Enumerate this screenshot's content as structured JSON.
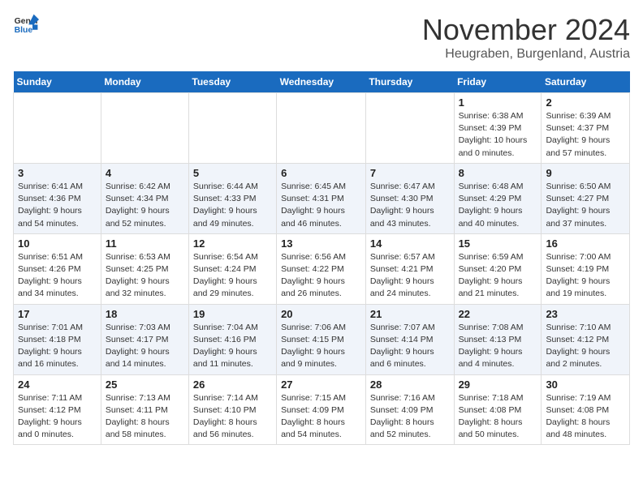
{
  "logo": {
    "general": "General",
    "blue": "Blue"
  },
  "header": {
    "month": "November 2024",
    "location": "Heugraben, Burgenland, Austria"
  },
  "weekdays": [
    "Sunday",
    "Monday",
    "Tuesday",
    "Wednesday",
    "Thursday",
    "Friday",
    "Saturday"
  ],
  "weeks": [
    [
      {
        "day": "",
        "info": ""
      },
      {
        "day": "",
        "info": ""
      },
      {
        "day": "",
        "info": ""
      },
      {
        "day": "",
        "info": ""
      },
      {
        "day": "",
        "info": ""
      },
      {
        "day": "1",
        "info": "Sunrise: 6:38 AM\nSunset: 4:39 PM\nDaylight: 10 hours and 0 minutes."
      },
      {
        "day": "2",
        "info": "Sunrise: 6:39 AM\nSunset: 4:37 PM\nDaylight: 9 hours and 57 minutes."
      }
    ],
    [
      {
        "day": "3",
        "info": "Sunrise: 6:41 AM\nSunset: 4:36 PM\nDaylight: 9 hours and 54 minutes."
      },
      {
        "day": "4",
        "info": "Sunrise: 6:42 AM\nSunset: 4:34 PM\nDaylight: 9 hours and 52 minutes."
      },
      {
        "day": "5",
        "info": "Sunrise: 6:44 AM\nSunset: 4:33 PM\nDaylight: 9 hours and 49 minutes."
      },
      {
        "day": "6",
        "info": "Sunrise: 6:45 AM\nSunset: 4:31 PM\nDaylight: 9 hours and 46 minutes."
      },
      {
        "day": "7",
        "info": "Sunrise: 6:47 AM\nSunset: 4:30 PM\nDaylight: 9 hours and 43 minutes."
      },
      {
        "day": "8",
        "info": "Sunrise: 6:48 AM\nSunset: 4:29 PM\nDaylight: 9 hours and 40 minutes."
      },
      {
        "day": "9",
        "info": "Sunrise: 6:50 AM\nSunset: 4:27 PM\nDaylight: 9 hours and 37 minutes."
      }
    ],
    [
      {
        "day": "10",
        "info": "Sunrise: 6:51 AM\nSunset: 4:26 PM\nDaylight: 9 hours and 34 minutes."
      },
      {
        "day": "11",
        "info": "Sunrise: 6:53 AM\nSunset: 4:25 PM\nDaylight: 9 hours and 32 minutes."
      },
      {
        "day": "12",
        "info": "Sunrise: 6:54 AM\nSunset: 4:24 PM\nDaylight: 9 hours and 29 minutes."
      },
      {
        "day": "13",
        "info": "Sunrise: 6:56 AM\nSunset: 4:22 PM\nDaylight: 9 hours and 26 minutes."
      },
      {
        "day": "14",
        "info": "Sunrise: 6:57 AM\nSunset: 4:21 PM\nDaylight: 9 hours and 24 minutes."
      },
      {
        "day": "15",
        "info": "Sunrise: 6:59 AM\nSunset: 4:20 PM\nDaylight: 9 hours and 21 minutes."
      },
      {
        "day": "16",
        "info": "Sunrise: 7:00 AM\nSunset: 4:19 PM\nDaylight: 9 hours and 19 minutes."
      }
    ],
    [
      {
        "day": "17",
        "info": "Sunrise: 7:01 AM\nSunset: 4:18 PM\nDaylight: 9 hours and 16 minutes."
      },
      {
        "day": "18",
        "info": "Sunrise: 7:03 AM\nSunset: 4:17 PM\nDaylight: 9 hours and 14 minutes."
      },
      {
        "day": "19",
        "info": "Sunrise: 7:04 AM\nSunset: 4:16 PM\nDaylight: 9 hours and 11 minutes."
      },
      {
        "day": "20",
        "info": "Sunrise: 7:06 AM\nSunset: 4:15 PM\nDaylight: 9 hours and 9 minutes."
      },
      {
        "day": "21",
        "info": "Sunrise: 7:07 AM\nSunset: 4:14 PM\nDaylight: 9 hours and 6 minutes."
      },
      {
        "day": "22",
        "info": "Sunrise: 7:08 AM\nSunset: 4:13 PM\nDaylight: 9 hours and 4 minutes."
      },
      {
        "day": "23",
        "info": "Sunrise: 7:10 AM\nSunset: 4:12 PM\nDaylight: 9 hours and 2 minutes."
      }
    ],
    [
      {
        "day": "24",
        "info": "Sunrise: 7:11 AM\nSunset: 4:12 PM\nDaylight: 9 hours and 0 minutes."
      },
      {
        "day": "25",
        "info": "Sunrise: 7:13 AM\nSunset: 4:11 PM\nDaylight: 8 hours and 58 minutes."
      },
      {
        "day": "26",
        "info": "Sunrise: 7:14 AM\nSunset: 4:10 PM\nDaylight: 8 hours and 56 minutes."
      },
      {
        "day": "27",
        "info": "Sunrise: 7:15 AM\nSunset: 4:09 PM\nDaylight: 8 hours and 54 minutes."
      },
      {
        "day": "28",
        "info": "Sunrise: 7:16 AM\nSunset: 4:09 PM\nDaylight: 8 hours and 52 minutes."
      },
      {
        "day": "29",
        "info": "Sunrise: 7:18 AM\nSunset: 4:08 PM\nDaylight: 8 hours and 50 minutes."
      },
      {
        "day": "30",
        "info": "Sunrise: 7:19 AM\nSunset: 4:08 PM\nDaylight: 8 hours and 48 minutes."
      }
    ]
  ]
}
